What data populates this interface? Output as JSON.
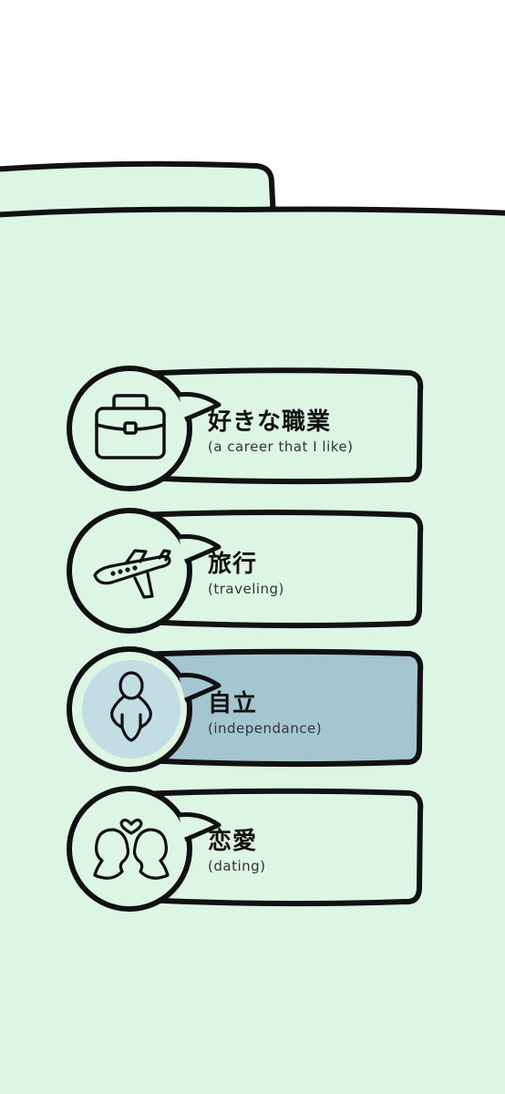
{
  "colors": {
    "panel_background": "#ddf5e3",
    "page_background": "#ffffff",
    "outline": "#111111",
    "selected_fill": "#a3c6d1",
    "selected_circle_fill": "#c2dde4"
  },
  "choices": [
    {
      "label_jp": "好きな職業",
      "label_en": "(a career that I like)",
      "icon": "briefcase-icon",
      "selected": false
    },
    {
      "label_jp": "旅行",
      "label_en": "(traveling)",
      "icon": "airplane-icon",
      "selected": false
    },
    {
      "label_jp": "自立",
      "label_en": "(independance)",
      "icon": "person-hands-on-hips-icon",
      "selected": true
    },
    {
      "label_jp": "恋愛",
      "label_en": "(dating)",
      "icon": "couple-heart-icon",
      "selected": false
    }
  ]
}
